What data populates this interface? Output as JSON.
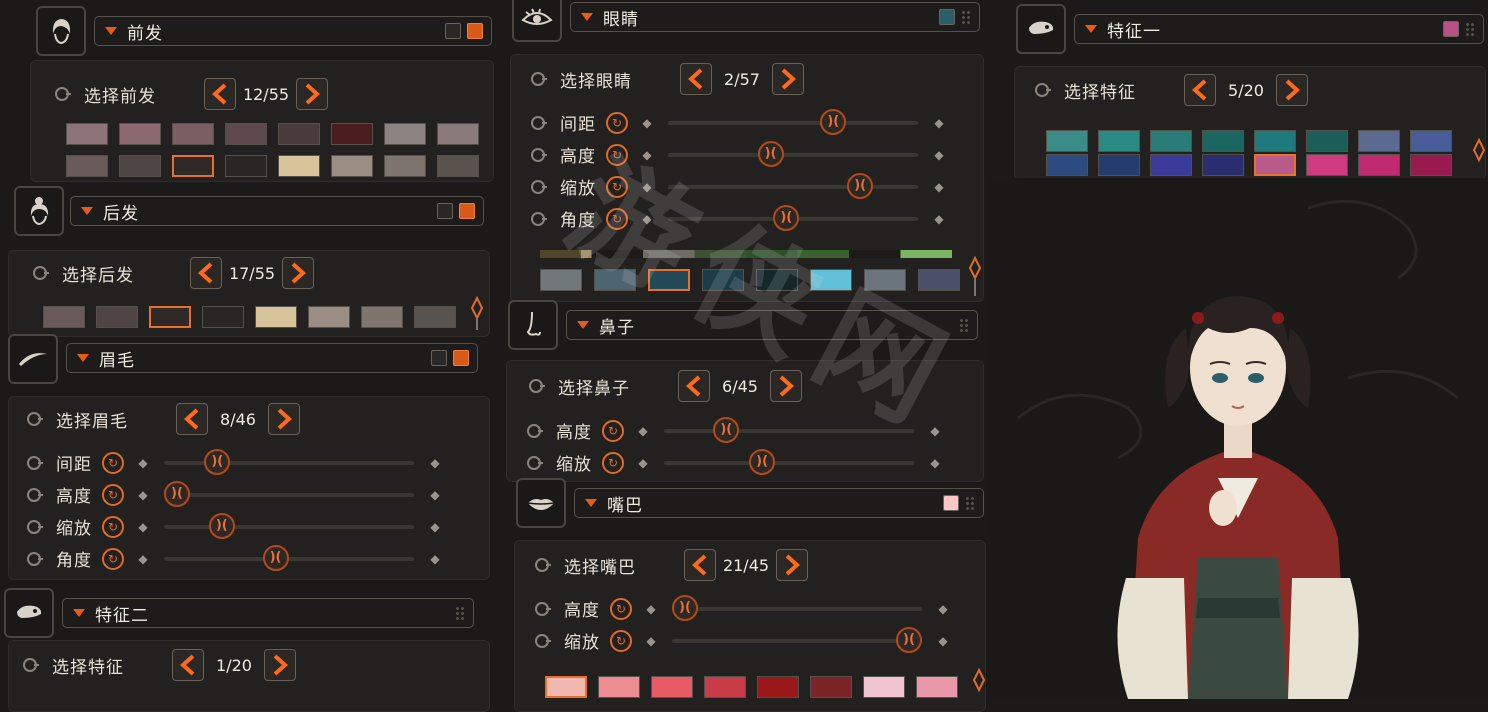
{
  "sections": {
    "front_hair": {
      "title": "前发",
      "select_label": "选择前发",
      "counter": "12/55"
    },
    "back_hair": {
      "title": "后发",
      "select_label": "选择后发",
      "counter": "17/55"
    },
    "eyebrow": {
      "title": "眉毛",
      "select_label": "选择眉毛",
      "counter": "8/46",
      "sliders": [
        {
          "label": "间距",
          "value": 0.18
        },
        {
          "label": "高度",
          "value": 0.0
        },
        {
          "label": "缩放",
          "value": 0.2
        },
        {
          "label": "角度",
          "value": 0.44
        }
      ]
    },
    "feature2": {
      "title": "特征二",
      "select_label": "选择特征",
      "counter": "1/20"
    },
    "eyes": {
      "title": "眼睛",
      "select_label": "选择眼睛",
      "counter": "2/57",
      "sliders": [
        {
          "label": "间距",
          "value": 0.68
        },
        {
          "label": "高度",
          "value": 0.4
        },
        {
          "label": "缩放",
          "value": 0.8
        },
        {
          "label": "角度",
          "value": 0.47
        }
      ]
    },
    "nose": {
      "title": "鼻子",
      "select_label": "选择鼻子",
      "counter": "6/45",
      "sliders": [
        {
          "label": "高度",
          "value": 0.22
        },
        {
          "label": "缩放",
          "value": 0.38
        }
      ]
    },
    "mouth": {
      "title": "嘴巴",
      "select_label": "选择嘴巴",
      "counter": "21/45",
      "sliders": [
        {
          "label": "高度",
          "value": 0.0
        },
        {
          "label": "缩放",
          "value": 1.0
        }
      ]
    },
    "feature1": {
      "title": "特征一",
      "select_label": "选择特征",
      "counter": "5/20"
    }
  },
  "colors": {
    "front_hair_row1": [
      "#8c7478",
      "#8a6a6e",
      "#7a5e62",
      "#5e4a4e",
      "#4a3a3c",
      "#4a1c20",
      "#8c8480",
      "#8a7a7a"
    ],
    "front_hair_row2": [
      "#6a5a5a",
      "#4e4444",
      "#2e2826",
      "#2a2624",
      "#d8c49a",
      "#9a8e84",
      "#7e766e",
      "#5a524c"
    ],
    "back_hair_row": [
      "#6a5a5a",
      "#4e4444",
      "#2e2826",
      "#2a2624",
      "#d8c49a",
      "#9a8e84",
      "#7e766e",
      "#5a524c"
    ],
    "eyes_row": [
      "#70787c",
      "#4e6470",
      "#244a58",
      "#1c3c48",
      "#14282c",
      "#62c0d8",
      "#6a747c",
      "#4a5068"
    ],
    "mouth_row": [
      "#f2b8b0",
      "#ee8c94",
      "#e85a64",
      "#c83c48",
      "#9a1a1c",
      "#7a2428",
      "#f0c4d0",
      "#e898a8"
    ],
    "feature1_row1": [
      "#3a8c88",
      "#2a8a84",
      "#2a7c78",
      "#1a6660",
      "#1e7a7c",
      "#1a5e58",
      "#5a6a90",
      "#485c9a"
    ],
    "feature1_row2": [
      "#2a4a80",
      "#253c6e",
      "#3a3a9a",
      "#2a2e70",
      "#b85a8a",
      "#d03a80",
      "#c02a70",
      "#9a1a50"
    ],
    "eyes_header_swatch": "#2c5e6a",
    "feature1_header_swatch": "#b8508a",
    "mouth_header_swatch": "#f8c8c8",
    "accent": "#e8702a"
  },
  "watermark": "游侠网"
}
